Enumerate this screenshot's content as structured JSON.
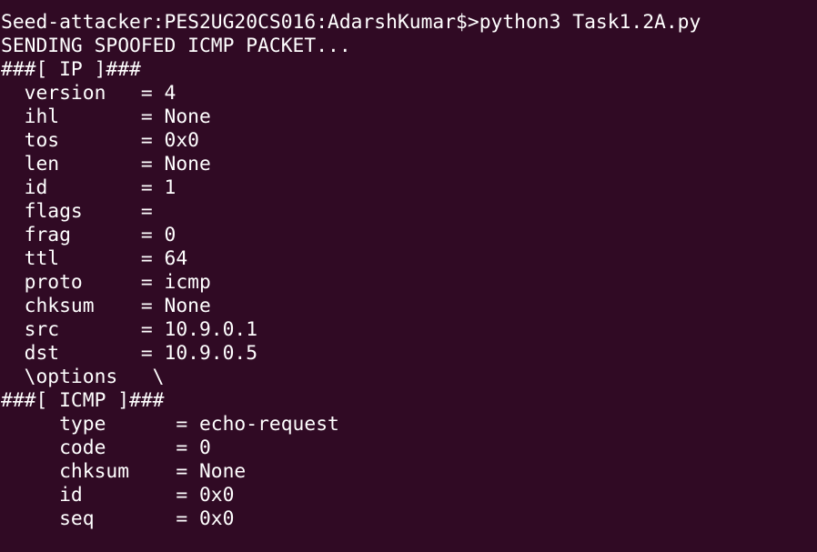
{
  "terminal": {
    "lines": [
      "Seed-attacker:PES2UG20CS016:AdarshKumar$>python3 Task1.2A.py",
      "SENDING SPOOFED ICMP PACKET...",
      "###[ IP ]###",
      "  version   = 4",
      "  ihl       = None",
      "  tos       = 0x0",
      "  len       = None",
      "  id        = 1",
      "  flags     = ",
      "  frag      = 0",
      "  ttl       = 64",
      "  proto     = icmp",
      "  chksum    = None",
      "  src       = 10.9.0.1",
      "  dst       = 10.9.0.5",
      "  \\options   \\",
      "###[ ICMP ]###",
      "     type      = echo-request",
      "     code      = 0",
      "     chksum    = None",
      "     id        = 0x0",
      "     seq       = 0x0"
    ]
  }
}
